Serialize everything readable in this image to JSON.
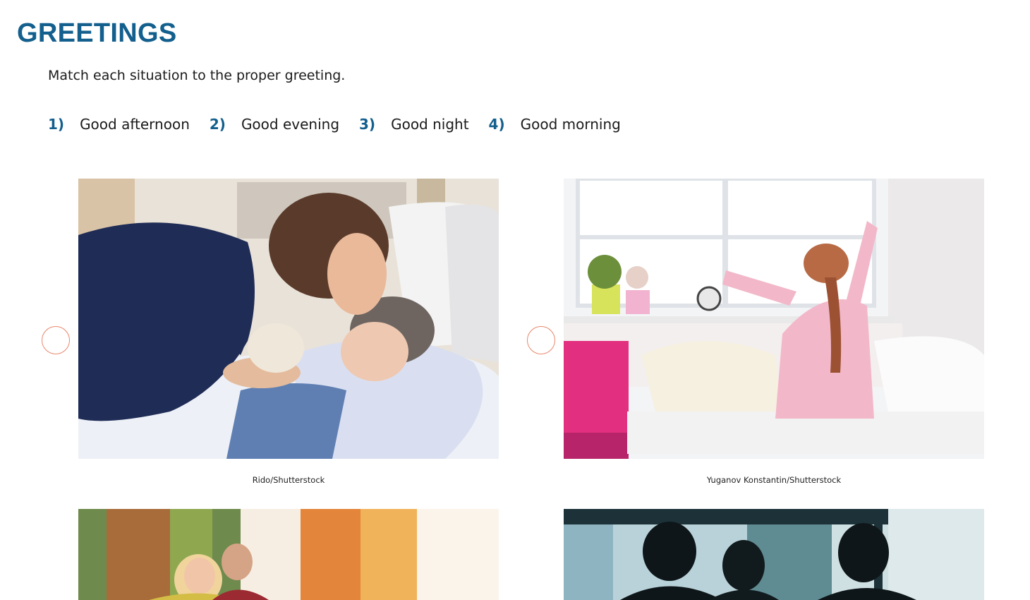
{
  "title": "GREETINGS",
  "instruction": "Match each situation to the proper greeting.",
  "options": [
    {
      "num": "1)",
      "label": "Good afternoon"
    },
    {
      "num": "2)",
      "label": "Good evening"
    },
    {
      "num": "3)",
      "label": "Good night"
    },
    {
      "num": "4)",
      "label": "Good morning"
    }
  ],
  "photos": [
    {
      "credit": "Rido/Shutterstock"
    },
    {
      "credit": "Yuganov Konstantin/Shutterstock"
    }
  ],
  "colors": {
    "heading": "#135f8d",
    "radio_border": "#e8866b"
  }
}
